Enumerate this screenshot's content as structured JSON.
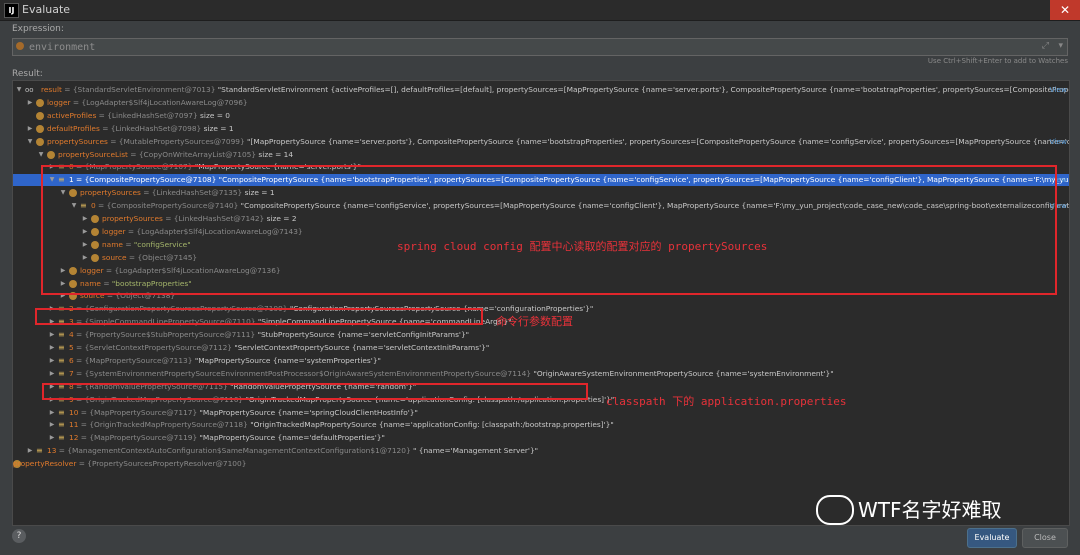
{
  "window": {
    "title": "Evaluate",
    "app_icon": "IJ"
  },
  "expression": {
    "label": "Expression:",
    "value": "environment",
    "hint": "Use Ctrl+Shift+Enter to add to Watches"
  },
  "result_label": "Result:",
  "tree": [
    {
      "t": "▼",
      "k": "oo",
      "n": "result",
      "ty": "{StandardServletEnvironment@7013}",
      "v": "\"StandardServletEnvironment {activeProfiles=[], defaultProfiles=[default], propertySources=[MapPropertySource {name='server.ports'}, CompositePropertySource {name='bootstrapProperties', propertySources=[CompositePropertySource {name='configService', propertySources=[MapPropertySource (r...",
      "view": "View"
    },
    {
      "t": "▶",
      "k": "f",
      "n": "logger",
      "ty": "{LogAdapter$Slf4jLocationAwareLog@7096}",
      "v": ""
    },
    {
      "t": "",
      "k": "f",
      "n": "activeProfiles",
      "ty": "{LinkedHashSet@7097}",
      "v": "size = 0"
    },
    {
      "t": "▶",
      "k": "f",
      "n": "defaultProfiles",
      "ty": "{LinkedHashSet@7098}",
      "v": "size = 1"
    },
    {
      "t": "▼",
      "k": "f",
      "n": "propertySources",
      "ty": "{MutablePropertySources@7099}",
      "v": "\"[MapPropertySource {name='server.ports'}, CompositePropertySource {name='bootstrapProperties', propertySources=[CompositePropertySource {name='configService', propertySources=[MapPropertySource {name='configCli...",
      "view": "View"
    },
    {
      "t": "▼",
      "k": "f",
      "n": "propertySourceList",
      "ty": "{CopyOnWriteArrayList@7105}",
      "v": "size = 14"
    },
    {
      "t": "▶",
      "k": "list",
      "n": "0",
      "ty": "{MapPropertySource@7107}",
      "v": "\"MapPropertySource {name='server.ports'}\""
    },
    {
      "t": "▼",
      "k": "list",
      "n": "1",
      "ty": "{CompositePropertySource@7108}",
      "v": "\"CompositePropertySource {name='bootstrapProperties', propertySources=[CompositePropertySource {name='configService', propertySources=[MapPropertySource {name='configClient'}, MapPropertySource {name='F:\\my_yun_project\\...",
      "view": "View",
      "sel": true
    },
    {
      "t": "▼",
      "k": "f",
      "n": "propertySources",
      "ty": "{LinkedHashSet@7135}",
      "v": "size = 1"
    },
    {
      "t": "▼",
      "k": "list",
      "n": "0",
      "ty": "{CompositePropertySource@7140}",
      "v": "\"CompositePropertySource {name='configService', propertySources=[MapPropertySource {name='configClient'}, MapPropertySource {name='F:\\my_yun_project\\code_case_new\\code_case\\spring-boot\\externalizeconfiguration\\ext-c...",
      "view": "View"
    },
    {
      "t": "▶",
      "k": "f",
      "n": "propertySources",
      "ty": "{LinkedHashSet@7142}",
      "v": "size = 2"
    },
    {
      "t": "▶",
      "k": "f",
      "n": "logger",
      "ty": "{LogAdapter$Slf4jLocationAwareLog@7143}",
      "v": ""
    },
    {
      "t": "▶",
      "k": "f",
      "n": "name",
      "ty": "",
      "v": "\"configService\"",
      "str": true
    },
    {
      "t": "▶",
      "k": "f",
      "n": "source",
      "ty": "{Object@7145}",
      "v": ""
    },
    {
      "t": "▶",
      "k": "f",
      "n": "logger",
      "ty": "{LogAdapter$Slf4jLocationAwareLog@7136}",
      "v": ""
    },
    {
      "t": "▶",
      "k": "f",
      "n": "name",
      "ty": "",
      "v": "\"bootstrapProperties\"",
      "str": true
    },
    {
      "t": "▶",
      "k": "f",
      "n": "source",
      "ty": "{Object@7138}",
      "v": ""
    },
    {
      "t": "▶",
      "k": "list",
      "n": "2",
      "ty": "{ConfigurationPropertySourcesPropertySource@7109}",
      "v": "\"ConfigurationPropertySourcesPropertySource {name='configurationProperties'}\""
    },
    {
      "t": "▶",
      "k": "list",
      "n": "3",
      "ty": "{SimpleCommandLinePropertySource@7110}",
      "v": "\"SimpleCommandLinePropertySource {name='commandLineArgs'}\""
    },
    {
      "t": "▶",
      "k": "list",
      "n": "4",
      "ty": "{PropertySource$StubPropertySource@7111}",
      "v": "\"StubPropertySource {name='servletConfigInitParams'}\""
    },
    {
      "t": "▶",
      "k": "list",
      "n": "5",
      "ty": "{ServletContextPropertySource@7112}",
      "v": "\"ServletContextPropertySource {name='servletContextInitParams'}\""
    },
    {
      "t": "▶",
      "k": "list",
      "n": "6",
      "ty": "{MapPropertySource@7113}",
      "v": "\"MapPropertySource {name='systemProperties'}\""
    },
    {
      "t": "▶",
      "k": "list",
      "n": "7",
      "ty": "{SystemEnvironmentPropertySourceEnvironmentPostProcessor$OriginAwareSystemEnvironmentPropertySource@7114}",
      "v": "\"OriginAwareSystemEnvironmentPropertySource {name='systemEnvironment'}\""
    },
    {
      "t": "▶",
      "k": "list",
      "n": "8",
      "ty": "{RandomValuePropertySource@7115}",
      "v": "\"RandomValuePropertySource {name='random'}\""
    },
    {
      "t": "▶",
      "k": "list",
      "n": "9",
      "ty": "{OriginTrackedMapPropertySource@7116}",
      "v": "\"OriginTrackedMapPropertySource {name='applicationConfig: [classpath:/application.properties]'}\""
    },
    {
      "t": "▶",
      "k": "list",
      "n": "10",
      "ty": "{MapPropertySource@7117}",
      "v": "\"MapPropertySource {name='springCloudClientHostInfo'}\""
    },
    {
      "t": "▶",
      "k": "list",
      "n": "11",
      "ty": "{OriginTrackedMapPropertySource@7118}",
      "v": "\"OriginTrackedMapPropertySource {name='applicationConfig: [classpath:/bootstrap.properties]'}\""
    },
    {
      "t": "▶",
      "k": "list",
      "n": "12",
      "ty": "{MapPropertySource@7119}",
      "v": "\"MapPropertySource {name='defaultProperties'}\""
    },
    {
      "t": "▶",
      "k": "list",
      "n": "13",
      "ty": "{ManagementContextAutoConfiguration$SameManagementContextConfiguration$1@7120}",
      "v": "\" {name='Management Server'}\""
    },
    {
      "t": "▶",
      "k": "f",
      "n": "propertyResolver",
      "ty": "{PropertySourcesPropertyResolver@7100}",
      "v": ""
    }
  ],
  "annotations": {
    "config": "spring cloud config 配置中心读取的配置对应的 propertySources",
    "cmdline": "命令行参数配置",
    "classpath": "classpath 下的 application.properties"
  },
  "watermark": "WTF名字好难取",
  "buttons": {
    "help": "?",
    "evaluate": "Evaluate",
    "close": "Close"
  }
}
